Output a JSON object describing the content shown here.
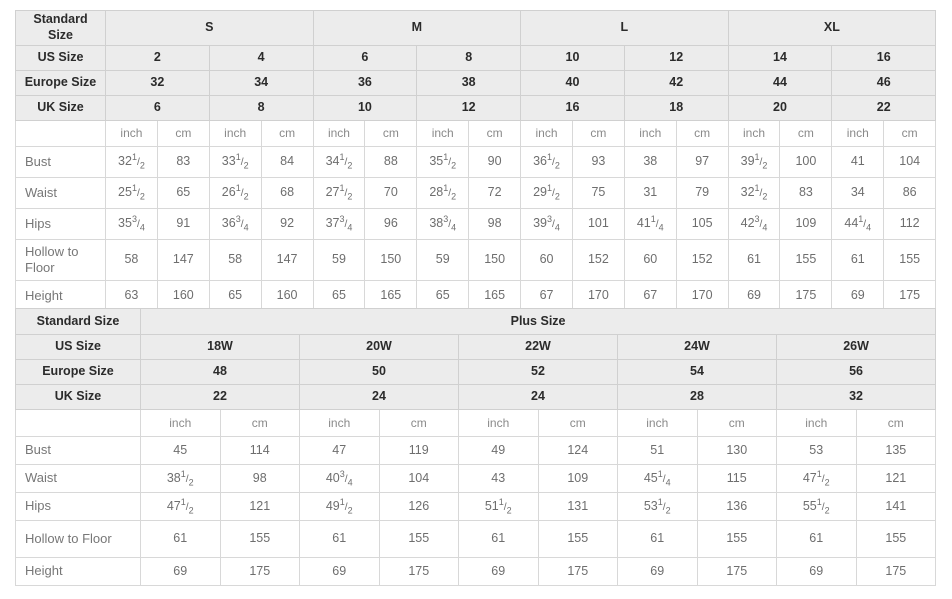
{
  "standard_table": {
    "corner_label": "Standard\nSize",
    "group_headers": [
      "S",
      "M",
      "L",
      "XL"
    ],
    "row_labels": {
      "us": "US Size",
      "europe": "Europe Size",
      "uk": "UK Size"
    },
    "us_sizes": [
      "2",
      "4",
      "6",
      "8",
      "10",
      "12",
      "14",
      "16"
    ],
    "europe_sizes": [
      "32",
      "34",
      "36",
      "38",
      "40",
      "42",
      "44",
      "46"
    ],
    "uk_sizes": [
      "6",
      "8",
      "10",
      "12",
      "16",
      "18",
      "20",
      "22"
    ],
    "unit_labels": [
      "inch",
      "cm",
      "inch",
      "cm",
      "inch",
      "cm",
      "inch",
      "cm",
      "inch",
      "cm",
      "inch",
      "cm",
      "inch",
      "cm",
      "inch",
      "cm"
    ],
    "unit_inch": "inch",
    "unit_cm": "cm",
    "measurements": [
      {
        "label": "Bust",
        "inch": [
          "32 1/2",
          "33 1/2",
          "34 1/2",
          "35 1/2",
          "36 1/2",
          "38",
          "39 1/2",
          "41"
        ],
        "cm": [
          "83",
          "84",
          "88",
          "90",
          "93",
          "97",
          "100",
          "104"
        ]
      },
      {
        "label": "Waist",
        "inch": [
          "25 1/2",
          "26 1/2",
          "27 1/2",
          "28 1/2",
          "29 1/2",
          "31",
          "32 1/2",
          "34"
        ],
        "cm": [
          "65",
          "68",
          "70",
          "72",
          "75",
          "79",
          "83",
          "86"
        ]
      },
      {
        "label": "Hips",
        "inch": [
          "35 3/4",
          "36 3/4",
          "37 3/4",
          "38 3/4",
          "39 3/4",
          "41 1/4",
          "42 3/4",
          "44 1/4"
        ],
        "cm": [
          "91",
          "92",
          "96",
          "98",
          "101",
          "105",
          "109",
          "112"
        ]
      },
      {
        "label": "Hollow to Floor",
        "inch": [
          "58",
          "58",
          "59",
          "59",
          "60",
          "60",
          "61",
          "61"
        ],
        "cm": [
          "147",
          "147",
          "150",
          "150",
          "152",
          "152",
          "155",
          "155"
        ]
      },
      {
        "label": "Height",
        "inch": [
          "63",
          "65",
          "65",
          "65",
          "67",
          "67",
          "69",
          "69"
        ],
        "cm": [
          "160",
          "160",
          "165",
          "165",
          "170",
          "170",
          "175",
          "175"
        ]
      }
    ]
  },
  "plus_table": {
    "corner_label": "Standard Size",
    "section_title": "Plus Size",
    "row_labels": {
      "us": "US Size",
      "europe": "Europe Size",
      "uk": "UK Size"
    },
    "us_sizes": [
      "18W",
      "20W",
      "22W",
      "24W",
      "26W"
    ],
    "europe_sizes": [
      "48",
      "50",
      "52",
      "54",
      "56"
    ],
    "uk_sizes": [
      "22",
      "24",
      "24",
      "28",
      "32"
    ],
    "unit_inch": "inch",
    "unit_cm": "cm",
    "measurements": [
      {
        "label": "Bust",
        "inch": [
          "45",
          "47",
          "49",
          "51",
          "53"
        ],
        "cm": [
          "114",
          "119",
          "124",
          "130",
          "135"
        ]
      },
      {
        "label": "Waist",
        "inch": [
          "38 1/2",
          "40 3/4",
          "43",
          "45 1/4",
          "47 1/2"
        ],
        "cm": [
          "98",
          "104",
          "109",
          "115",
          "121"
        ]
      },
      {
        "label": "Hips",
        "inch": [
          "47 1/2",
          "49 1/2",
          "51 1/2",
          "53 1/2",
          "55 1/2"
        ],
        "cm": [
          "121",
          "126",
          "131",
          "136",
          "141"
        ]
      },
      {
        "label": "Hollow to Floor",
        "inch": [
          "61",
          "61",
          "61",
          "61",
          "61"
        ],
        "cm": [
          "155",
          "155",
          "155",
          "155",
          "155"
        ]
      },
      {
        "label": "Height",
        "inch": [
          "69",
          "69",
          "69",
          "69",
          "69"
        ],
        "cm": [
          "175",
          "175",
          "175",
          "175",
          "175"
        ]
      }
    ]
  },
  "colors": {
    "header_bg": "#ececec",
    "header_text": "#2b2b2b",
    "cell_text": "#6e6e6e",
    "border": "#d8d8d8",
    "page_bg": "#ffffff"
  }
}
